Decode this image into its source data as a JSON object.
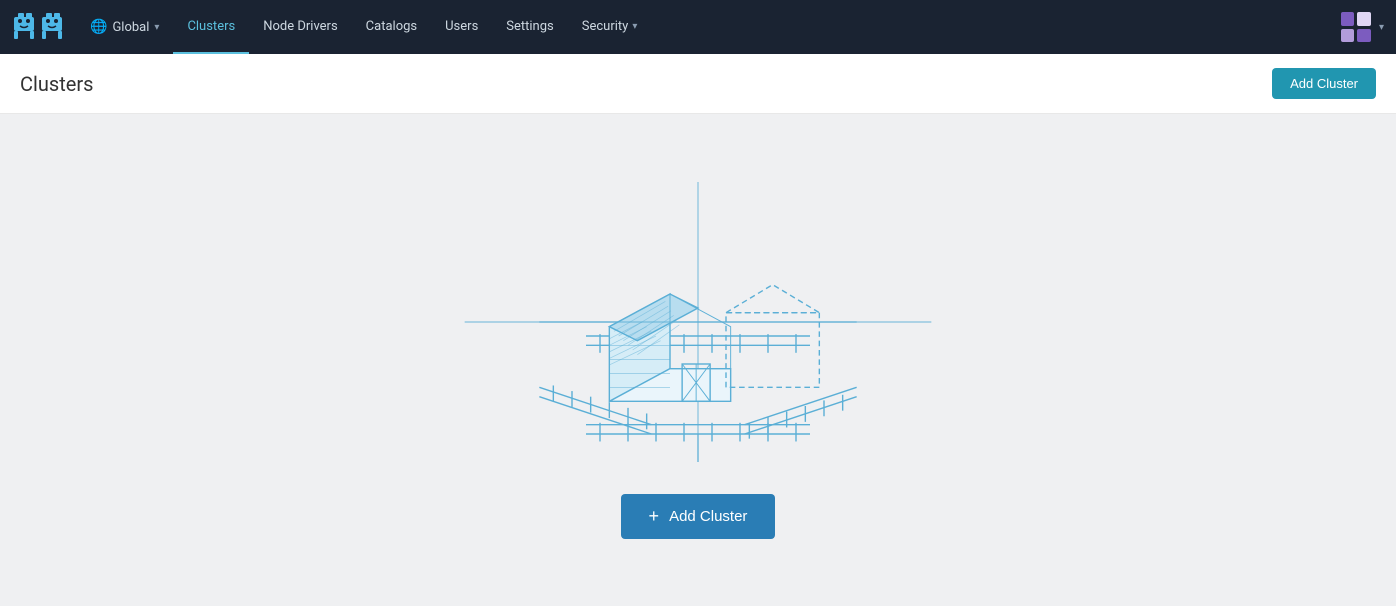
{
  "navbar": {
    "logo_alt": "Rancher Logo",
    "global_label": "Global",
    "nav_items": [
      {
        "label": "Clusters",
        "active": true
      },
      {
        "label": "Node Drivers",
        "active": false
      },
      {
        "label": "Catalogs",
        "active": false
      },
      {
        "label": "Users",
        "active": false
      },
      {
        "label": "Settings",
        "active": false
      },
      {
        "label": "Security",
        "active": false,
        "has_dropdown": true
      }
    ]
  },
  "page": {
    "title": "Clusters",
    "add_cluster_btn_label": "Add Cluster",
    "add_cluster_center_btn_label": "Add Cluster",
    "plus_symbol": "+"
  }
}
